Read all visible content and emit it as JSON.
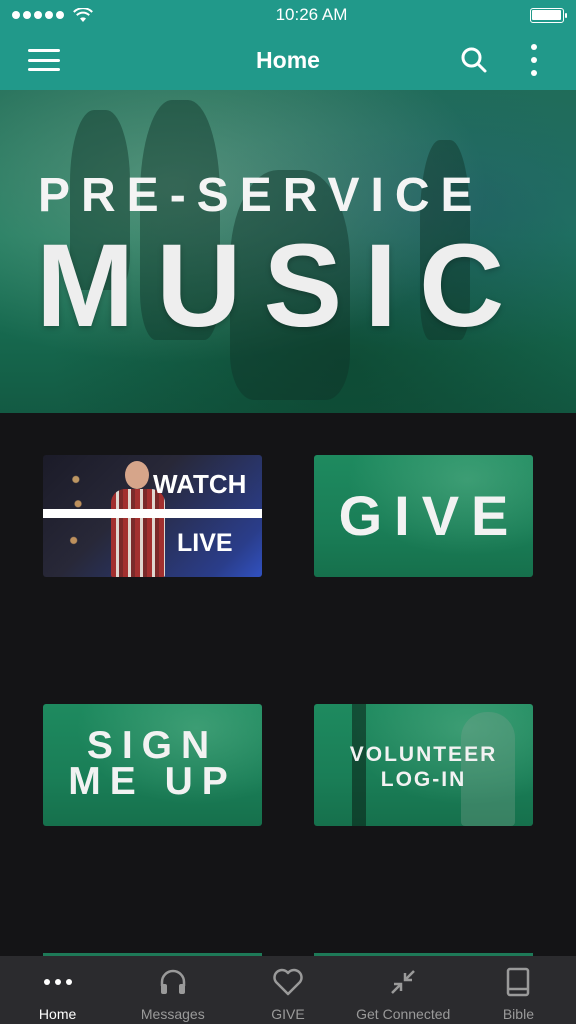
{
  "status": {
    "time": "10:26 AM",
    "signal_icon": "signal-dots-icon",
    "wifi_icon": "wifi-icon",
    "battery_icon": "battery-icon",
    "battery_level": 1.0
  },
  "nav": {
    "title": "Home",
    "menu_icon": "hamburger-icon",
    "search_icon": "search-icon",
    "more_icon": "more-vertical-icon",
    "bar_color": "#21998a"
  },
  "hero": {
    "line1": "PRE-SERVICE",
    "line2": "MUSIC"
  },
  "tiles": {
    "watch": {
      "line1": "WATCH",
      "line2": "LIVE"
    },
    "give": {
      "label": "GIVE"
    },
    "signup": {
      "label": "SIGN\nME UP"
    },
    "volunteer": {
      "label": "VOLUNTEER\nLOG-IN"
    }
  },
  "tabs": [
    {
      "label": "Home",
      "icon": "more-horizontal-icon",
      "active": true
    },
    {
      "label": "Messages",
      "icon": "headphones-icon",
      "active": false
    },
    {
      "label": "GIVE",
      "icon": "heart-icon",
      "active": false
    },
    {
      "label": "Get Connected",
      "icon": "arrows-in-icon",
      "active": false
    },
    {
      "label": "Bible",
      "icon": "book-icon",
      "active": false
    }
  ],
  "colors": {
    "accent": "#21998a",
    "background": "#141416",
    "tab_bar": "#2b2b2e",
    "tile_green": "#1e8a5f"
  }
}
